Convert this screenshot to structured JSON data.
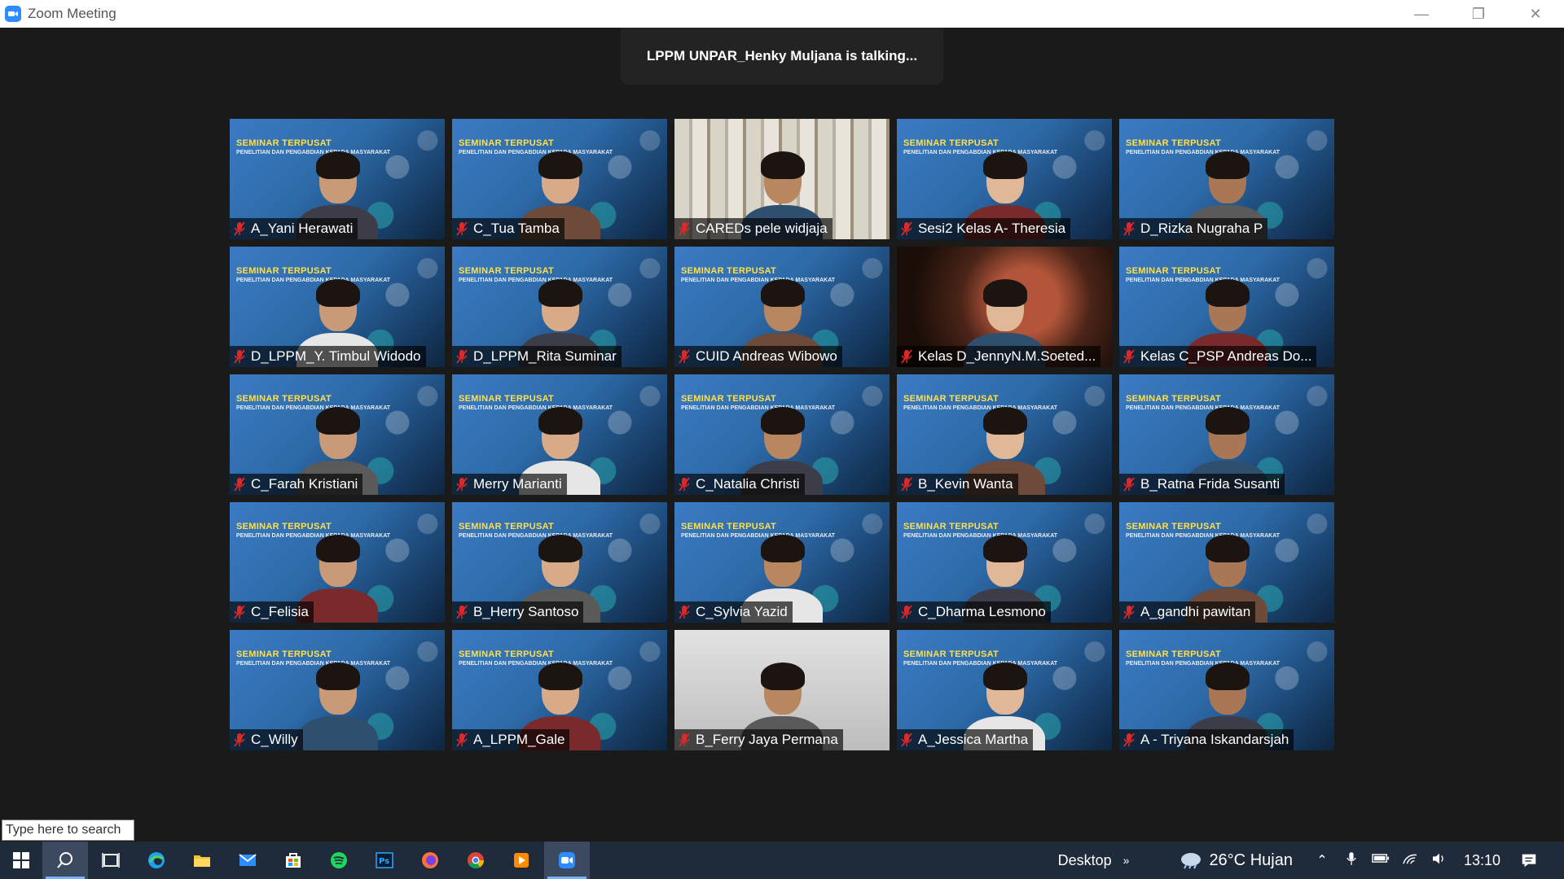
{
  "window": {
    "title": "Zoom Meeting",
    "controls": {
      "minimize": "—",
      "restore": "❐",
      "close": "✕"
    }
  },
  "meeting": {
    "talking_banner": "LPPM UNPAR_Henky Muljana is talking...",
    "participants": [
      {
        "name": "A_Yani Herawati",
        "bg": "slide"
      },
      {
        "name": "C_Tua Tamba",
        "bg": "slide"
      },
      {
        "name": "CAREDs pele widjaja",
        "bg": "books"
      },
      {
        "name": "Sesi2 Kelas A- Theresia",
        "bg": "slide"
      },
      {
        "name": "D_Rizka Nugraha P",
        "bg": "slide"
      },
      {
        "name": "D_LPPM_Y. Timbul Widodo",
        "bg": "slide"
      },
      {
        "name": "D_LPPM_Rita Suminar",
        "bg": "slide"
      },
      {
        "name": "CUID Andreas Wibowo",
        "bg": "slide"
      },
      {
        "name": "Kelas D_JennyN.M.Soeted...",
        "bg": "dark"
      },
      {
        "name": "Kelas C_PSP Andreas Do...",
        "bg": "slide"
      },
      {
        "name": "C_Farah Kristiani",
        "bg": "slide"
      },
      {
        "name": "Merry Marianti",
        "bg": "slide"
      },
      {
        "name": "C_Natalia Christi",
        "bg": "slide"
      },
      {
        "name": "B_Kevin Wanta",
        "bg": "slide"
      },
      {
        "name": "B_Ratna Frida Susanti",
        "bg": "slide"
      },
      {
        "name": "C_Felisia",
        "bg": "slide"
      },
      {
        "name": "B_Herry Santoso",
        "bg": "slide"
      },
      {
        "name": "C_Sylvia Yazid",
        "bg": "slide"
      },
      {
        "name": "C_Dharma Lesmono",
        "bg": "slide"
      },
      {
        "name": "A_gandhi pawitan",
        "bg": "slide"
      },
      {
        "name": "C_Willy",
        "bg": "slide"
      },
      {
        "name": "A_LPPM_Gale",
        "bg": "slide"
      },
      {
        "name": "B_Ferry Jaya Permana",
        "bg": "plain"
      },
      {
        "name": "A_Jessica Martha",
        "bg": "slide"
      },
      {
        "name": "A - Triyana Iskandarsjah",
        "bg": "slide"
      }
    ],
    "slide_title": "SEMINAR TERPUSAT",
    "slide_subtitle": "PENELITIAN DAN PENGABDIAN KEPADA MASYARAKAT"
  },
  "taskbar": {
    "search_placeholder": "Type here to search",
    "desktop_label": "Desktop",
    "chevron": "»",
    "weather": {
      "temp": "26°C",
      "condition": "Hujan"
    },
    "clock": "13:10",
    "accent_color": "#2D8CFF"
  }
}
